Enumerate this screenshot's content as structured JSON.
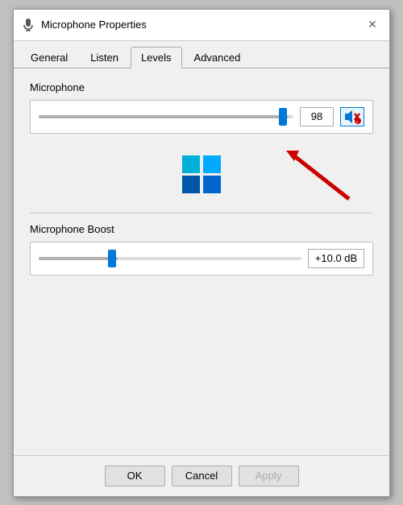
{
  "window": {
    "title": "Microphone Properties",
    "icon": "microphone-icon"
  },
  "tabs": [
    {
      "id": "general",
      "label": "General",
      "active": false
    },
    {
      "id": "listen",
      "label": "Listen",
      "active": false
    },
    {
      "id": "levels",
      "label": "Levels",
      "active": true
    },
    {
      "id": "advanced",
      "label": "Advanced",
      "active": false
    }
  ],
  "levels": {
    "microphone": {
      "label": "Microphone",
      "value": 98,
      "percent": 98,
      "muted": false
    },
    "boost": {
      "label": "Microphone Boost",
      "value": "+10.0 dB",
      "percent": 30
    }
  },
  "footer": {
    "ok_label": "OK",
    "cancel_label": "Cancel",
    "apply_label": "Apply"
  },
  "close_label": "✕"
}
